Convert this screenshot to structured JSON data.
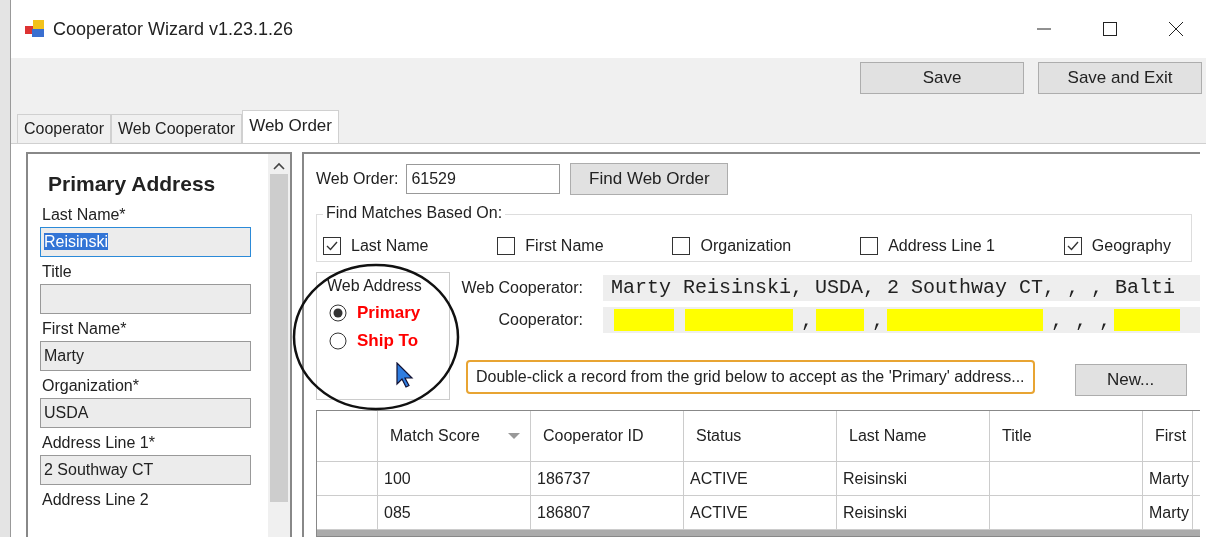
{
  "window": {
    "title": "Cooperator Wizard v1.23.1.26"
  },
  "toolbar": {
    "buttons": [
      "Save",
      "Save and Exit"
    ]
  },
  "tabs": [
    {
      "label": "Cooperator",
      "selected": false
    },
    {
      "label": "Web Cooperator",
      "selected": false
    },
    {
      "label": "Web Order",
      "selected": true
    }
  ],
  "primary_address": {
    "heading": "Primary Address",
    "fields": [
      {
        "kind": "field",
        "label": "Last Name*",
        "value": "Reisinski",
        "focused": true
      },
      {
        "kind": "field",
        "label": "Title",
        "focused": false
      },
      {
        "kind": "field",
        "label": "First Name*",
        "value": "Marty",
        "focused": false
      },
      {
        "kind": "field",
        "label": "Organization*",
        "value": "USDA",
        "focused": false
      },
      {
        "kind": "field",
        "label": "Address Line 1*",
        "value": "2 Southway CT",
        "focused": false
      },
      {
        "kind": "label",
        "label": "Address Line 2"
      }
    ]
  },
  "web_order": {
    "label": "Web Order:",
    "value": "61529",
    "button": "Find Web Order"
  },
  "find_matches": {
    "title": "Find Matches Based On:",
    "options": [
      {
        "label": "Last Name",
        "checked": true
      },
      {
        "label": "First Name",
        "checked": false
      },
      {
        "label": "Organization",
        "checked": false
      },
      {
        "label": "Address Line 1",
        "checked": false
      },
      {
        "label": "Geography",
        "checked": true
      }
    ]
  },
  "web_address": {
    "title": "Web Address",
    "options": [
      {
        "label": "Primary",
        "selected": true
      },
      {
        "label": "Ship To",
        "selected": false
      }
    ]
  },
  "web_cooperator": {
    "label": "Web Cooperator:",
    "value": "Marty Reisinski, USDA, 2 Southway CT, , , Balti"
  },
  "cooperator": {
    "label": "Cooperator:",
    "segments": [
      {
        "kind": "field",
        "highlighted": true
      },
      {
        "kind": "field",
        "highlighted": true
      },
      {
        "kind": "text",
        "text": ","
      },
      {
        "kind": "field",
        "highlighted": true
      },
      {
        "kind": "text",
        "text": ","
      },
      {
        "kind": "field",
        "highlighted": true
      },
      {
        "kind": "text",
        "text": ", , ,"
      },
      {
        "kind": "field",
        "highlighted": true
      }
    ]
  },
  "hint": "Double-click a record from the grid below to accept as the 'Primary' address...",
  "new_button": "New...",
  "grid": {
    "columns": [
      {
        "label": "Match Score",
        "sorted": true
      },
      {
        "label": "Cooperator ID",
        "sorted": false
      },
      {
        "label": "Status",
        "sorted": false
      },
      {
        "label": "Last Name",
        "sorted": false
      },
      {
        "label": "Title",
        "sorted": false
      },
      {
        "label": "First",
        "sorted": false
      }
    ],
    "rows": [
      [
        "100",
        "186737",
        "ACTIVE",
        "Reisinski",
        "",
        "Marty"
      ],
      [
        "085",
        "186807",
        "ACTIVE",
        "Reisinski",
        "",
        "Marty"
      ]
    ]
  }
}
